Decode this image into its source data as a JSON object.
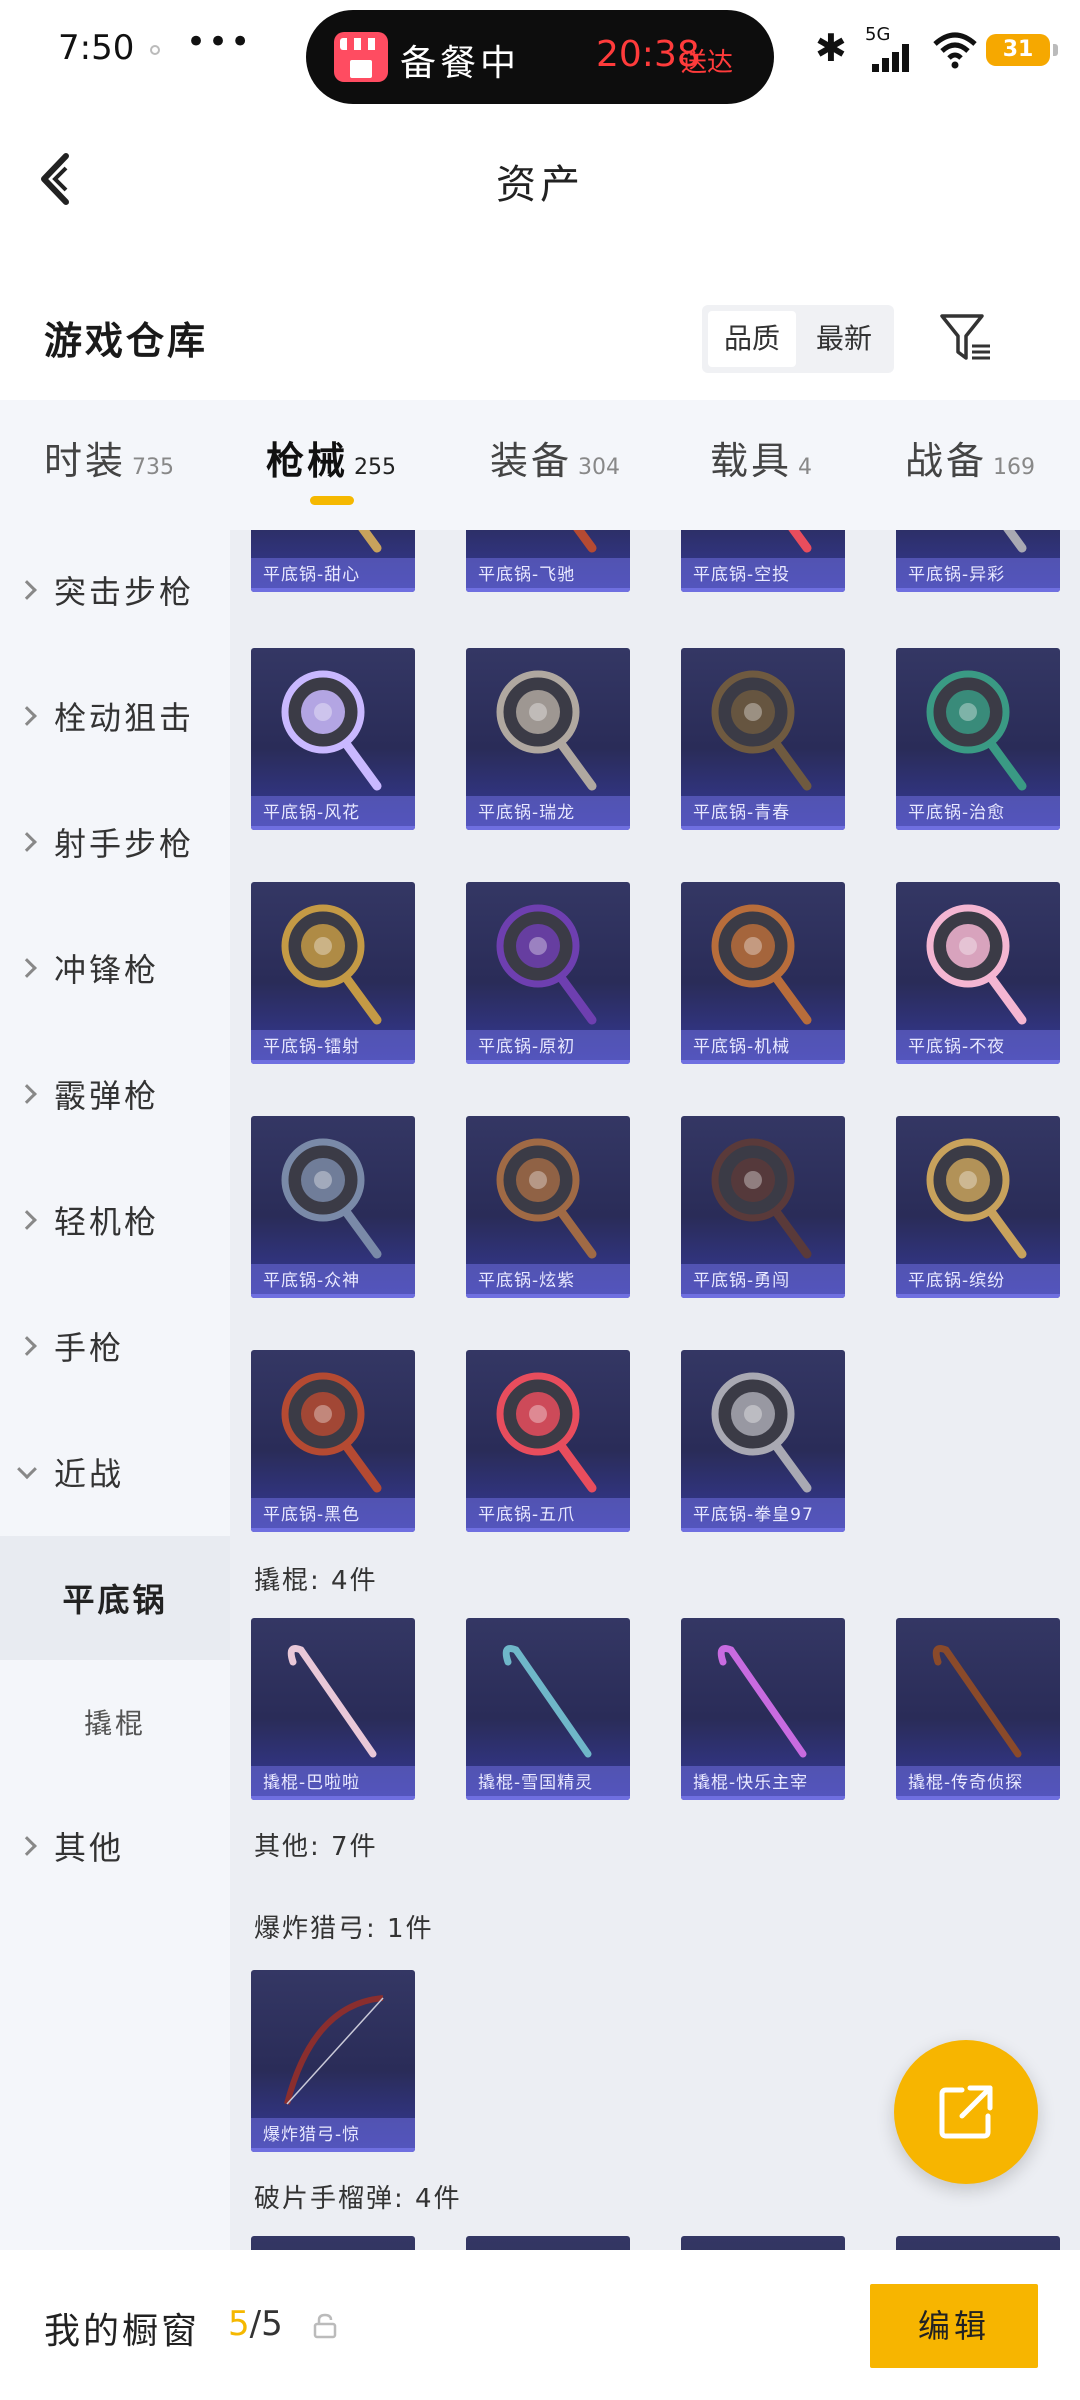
{
  "status_bar": {
    "time": "7:50",
    "dots": "•••",
    "pill_text": "备餐中",
    "pill_time": "20:38",
    "pill_suffix": "送达",
    "network": "5G",
    "battery": "31"
  },
  "header": {
    "title": "资产"
  },
  "section": {
    "title": "游戏仓库",
    "sort_options": [
      "品质",
      "最新"
    ],
    "active_sort": "品质"
  },
  "tabs": [
    {
      "label": "时装",
      "count": "735"
    },
    {
      "label": "枪械",
      "count": "255",
      "active": true
    },
    {
      "label": "装备",
      "count": "304"
    },
    {
      "label": "载具",
      "count": "4"
    },
    {
      "label": "战备",
      "count": "169"
    }
  ],
  "sidebar": {
    "items": [
      "突击步枪",
      "栓动狙击",
      "射手步枪",
      "冲锋枪",
      "霰弹枪",
      "轻机枪",
      "手枪",
      "近战"
    ],
    "sub_active": "平底锅",
    "sub_other": "撬棍",
    "last": "其他"
  },
  "grid": {
    "partial_row": [
      "平底锅-甜心",
      "平底锅-飞驰",
      "平底锅-空投",
      "平底锅-异彩"
    ],
    "pans": [
      [
        "平底锅-风花",
        "平底锅-瑞龙",
        "平底锅-青春",
        "平底锅-治愈"
      ],
      [
        "平底锅-镭射",
        "平底锅-原初",
        "平底锅-机械",
        "平底锅-不夜"
      ],
      [
        "平底锅-众神",
        "平底锅-炫紫",
        "平底锅-勇闯",
        "平底锅-缤纷"
      ],
      [
        "平底锅-黑色",
        "平底锅-五爪",
        "平底锅-拳皇97"
      ]
    ],
    "crowbar_header": "撬棍: 4件",
    "crowbars": [
      "撬棍-巴啦啦",
      "撬棍-雪国精灵",
      "撬棍-快乐主宰",
      "撬棍-传奇侦探"
    ],
    "other_header": "其他: 7件",
    "bow_header": "爆炸猎弓: 1件",
    "bows": [
      "爆炸猎弓-惊"
    ],
    "grenade_header": "破片手榴弹: 4件"
  },
  "bottom_bar": {
    "label": "我的橱窗",
    "count_current": "5",
    "count_total": "/5",
    "edit_label": "编辑"
  },
  "colors": {
    "accent": "#f7b500",
    "card_bg": "#2f3160",
    "card_label": "#6f6fe0",
    "sidebar_bg": "#f4f6fa",
    "content_bg": "#eceef3"
  }
}
